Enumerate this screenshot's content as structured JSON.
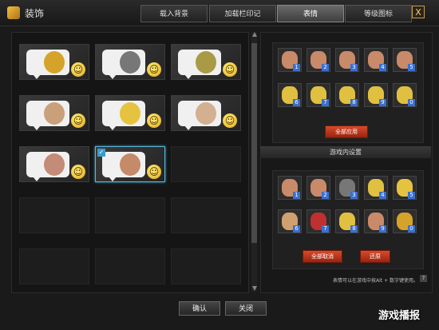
{
  "window": {
    "title": "装饰"
  },
  "tabs": [
    {
      "label": "载入背景",
      "active": false
    },
    {
      "label": "加载栏印记",
      "active": false
    },
    {
      "label": "表情",
      "active": true
    },
    {
      "label": "等级图标",
      "active": false
    }
  ],
  "close_label": "X",
  "emote_packs": [
    {
      "filled": true,
      "selected": false,
      "color": "#d6a32a"
    },
    {
      "filled": true,
      "selected": false,
      "color": "#777777"
    },
    {
      "filled": true,
      "selected": false,
      "color": "#a99a45"
    },
    {
      "filled": true,
      "selected": false,
      "color": "#c9a07a"
    },
    {
      "filled": true,
      "selected": false,
      "color": "#e6c33e"
    },
    {
      "filled": true,
      "selected": false,
      "color": "#d3b08f"
    },
    {
      "filled": true,
      "selected": false,
      "color": "#c48b78"
    },
    {
      "filled": true,
      "selected": true,
      "color": "#c48a6a"
    },
    {
      "filled": false,
      "selected": false,
      "color": ""
    },
    {
      "filled": false,
      "selected": false,
      "color": ""
    },
    {
      "filled": false,
      "selected": false,
      "color": ""
    },
    {
      "filled": false,
      "selected": false,
      "color": ""
    },
    {
      "filled": false,
      "selected": false,
      "color": ""
    },
    {
      "filled": false,
      "selected": false,
      "color": ""
    },
    {
      "filled": false,
      "selected": false,
      "color": ""
    }
  ],
  "preview": {
    "slots": [
      {
        "num": "1",
        "color": "#c98a6a"
      },
      {
        "num": "2",
        "color": "#c98a6a"
      },
      {
        "num": "3",
        "color": "#c98a6a"
      },
      {
        "num": "4",
        "color": "#c98a6a"
      },
      {
        "num": "5",
        "color": "#c98a6a"
      },
      {
        "num": "6",
        "color": "#e0c040"
      },
      {
        "num": "7",
        "color": "#e0c040"
      },
      {
        "num": "8",
        "color": "#e0c040"
      },
      {
        "num": "9",
        "color": "#e0c040"
      },
      {
        "num": "0",
        "color": "#e0c040"
      }
    ],
    "apply_all_label": "全部应用"
  },
  "ingame": {
    "header": "游戏内设置",
    "slots": [
      {
        "num": "1",
        "color": "#c98a6a"
      },
      {
        "num": "2",
        "color": "#c98a6a"
      },
      {
        "num": "3",
        "color": "#777777"
      },
      {
        "num": "4",
        "color": "#e0c040"
      },
      {
        "num": "5",
        "color": "#e6c33e"
      },
      {
        "num": "6",
        "color": "#d0a070"
      },
      {
        "num": "7",
        "color": "#c03030"
      },
      {
        "num": "8",
        "color": "#e0c040"
      },
      {
        "num": "9",
        "color": "#c98a6a"
      },
      {
        "num": "0",
        "color": "#d6a32a"
      }
    ],
    "cancel_all_label": "全部取消",
    "restore_label": "还原"
  },
  "note": "表情可以在游戏中按Alt + 数字键使用。",
  "help_label": "?",
  "buttons": {
    "confirm": "确认",
    "close": "关闭"
  },
  "watermark": "游戏播报"
}
